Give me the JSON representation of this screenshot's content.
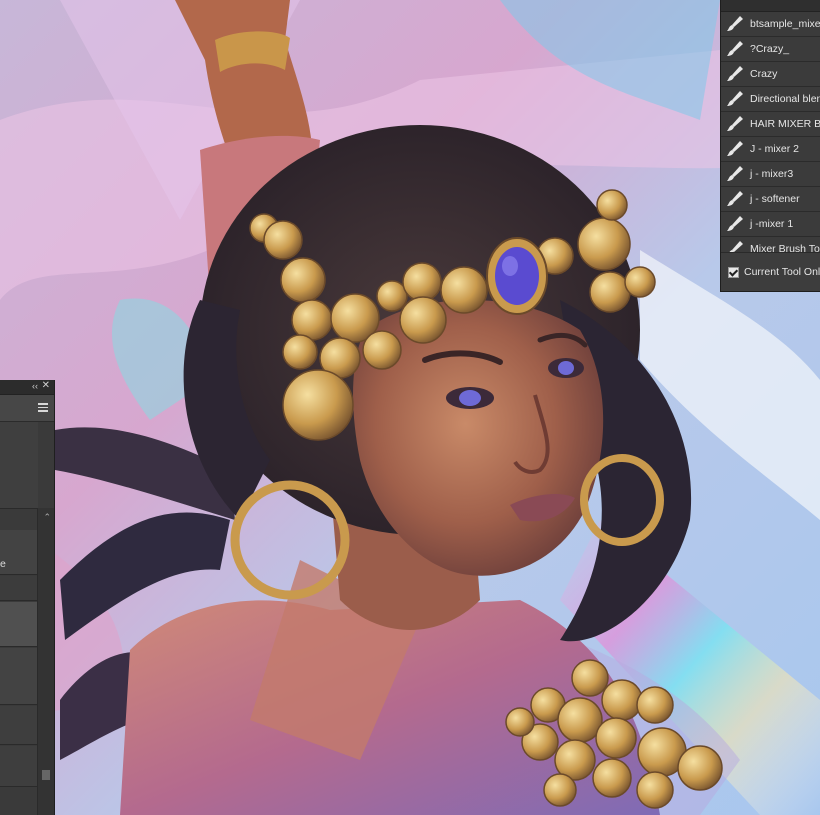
{
  "tool_presets": {
    "items": [
      {
        "label": "btsample_mixer",
        "icon": "brush-icon"
      },
      {
        "label": "?Crazy_",
        "icon": "brush-icon"
      },
      {
        "label": "Crazy",
        "icon": "brush-icon"
      },
      {
        "label": "Directional blend",
        "icon": "brush-icon"
      },
      {
        "label": "HAIR MIXER BR",
        "icon": "brush-icon"
      },
      {
        "label": "J - mixer 2",
        "icon": "brush-icon"
      },
      {
        "label": "j - mixer3",
        "icon": "brush-icon"
      },
      {
        "label": "j - softener",
        "icon": "brush-icon"
      },
      {
        "label": "j -mixer 1",
        "icon": "brush-icon"
      },
      {
        "label": "Mixer Brush To",
        "icon": "brush-icon"
      }
    ],
    "current_tool_only": {
      "label": "Current Tool Only",
      "checked": true
    }
  },
  "left_panel": {
    "collapse_glyph": "‹‹",
    "close_glyph": "✕",
    "partial_label": "e",
    "scroll_up_glyph": "⌃"
  }
}
